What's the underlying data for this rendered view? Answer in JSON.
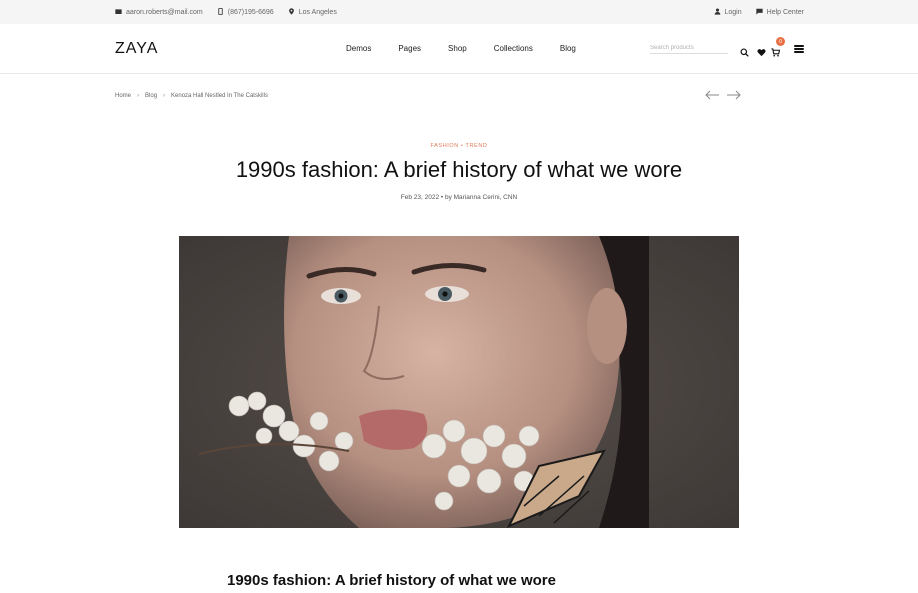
{
  "topbar": {
    "email": "aaron.roberts@mail.com",
    "phone": "(867)195-6696",
    "location": "Los Angeles",
    "login": "Login",
    "help": "Help Center"
  },
  "header": {
    "logo": "ZAYA",
    "nav": [
      "Demos",
      "Pages",
      "Shop",
      "Collections",
      "Blog"
    ],
    "search_placeholder": "Search products",
    "cart_count": "0"
  },
  "breadcrumb": {
    "items": [
      "Home",
      "Blog",
      "Kenoza Hall Nestled In The Catskills"
    ]
  },
  "article": {
    "category": "FASHION • TREND",
    "title": "1990s fashion: A brief history of what we wore",
    "meta": "Feb 23, 2022 • by Marianna Cerini, CNN",
    "subtitle": "1990s fashion: A brief history of what we wore"
  },
  "colors": {
    "accent": "#e07a55",
    "badge": "#e76f43"
  }
}
